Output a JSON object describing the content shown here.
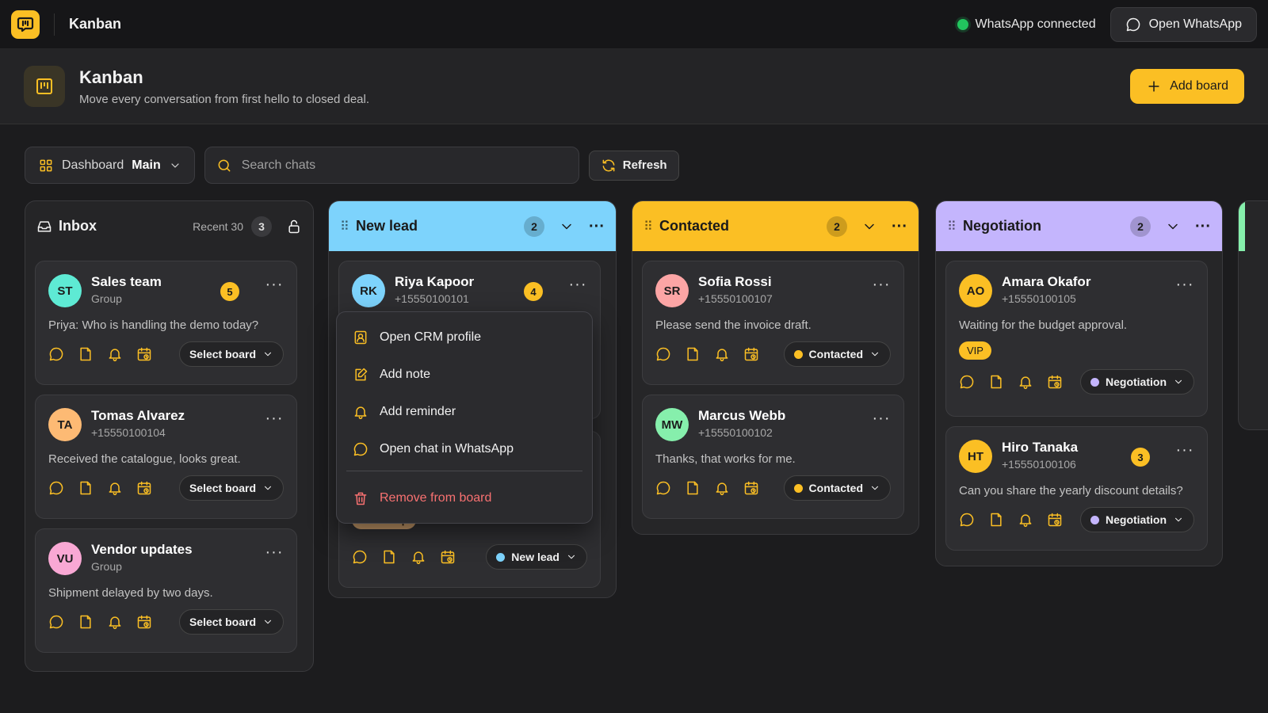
{
  "topbar": {
    "app_name": "Kanban",
    "status": "WhatsApp connected",
    "open_whatsapp": "Open WhatsApp"
  },
  "header": {
    "title": "Kanban",
    "subtitle": "Move every conversation from first hello to closed deal.",
    "add_board": "Add board"
  },
  "toolbar": {
    "dashboard_label": "Dashboard",
    "dashboard_value": "Main",
    "search_placeholder": "Search chats",
    "refresh": "Refresh"
  },
  "inbox": {
    "title": "Inbox",
    "recent_label": "Recent 30",
    "count": "3",
    "cards": [
      {
        "initials": "ST",
        "name": "Sales team",
        "sub": "Group",
        "unread": "5",
        "message": "Priya: Who is handling the demo today?",
        "board": "Select board",
        "avatar_color": "#5eead4"
      },
      {
        "initials": "TA",
        "name": "Tomas Alvarez",
        "sub": "+15550100104",
        "message": "Received the catalogue, looks great.",
        "board": "Select board",
        "avatar_color": "#fdba74"
      },
      {
        "initials": "VU",
        "name": "Vendor updates",
        "sub": "Group",
        "message": "Shipment delayed by two days.",
        "board": "Select board",
        "avatar_color": "#f9a8d4"
      }
    ]
  },
  "columns": [
    {
      "title": "New lead",
      "count": "2",
      "color": "#7dd3fc",
      "cards": [
        {
          "initials": "RK",
          "name": "Riya Kapoor",
          "sub": "+15550100101",
          "unread": "4",
          "avatar_color": "#7dd3fc"
        },
        {
          "tag": "Follow up",
          "board": "New lead",
          "status_color": "#7dd3fc"
        }
      ]
    },
    {
      "title": "Contacted",
      "count": "2",
      "color": "#fbbf24",
      "cards": [
        {
          "initials": "SR",
          "name": "Sofia Rossi",
          "sub": "+15550100107",
          "message": "Please send the invoice draft.",
          "board": "Contacted",
          "avatar_color": "#fca5a5"
        },
        {
          "initials": "MW",
          "name": "Marcus Webb",
          "sub": "+15550100102",
          "message": "Thanks, that works for me.",
          "board": "Contacted",
          "avatar_color": "#86efac"
        }
      ]
    },
    {
      "title": "Negotiation",
      "count": "2",
      "color": "#c4b5fd",
      "cards": [
        {
          "initials": "AO",
          "name": "Amara Okafor",
          "sub": "+15550100105",
          "message": "Waiting for the budget approval.",
          "tag": "VIP",
          "board": "Negotiation",
          "avatar_color": "#fbbf24"
        },
        {
          "initials": "HT",
          "name": "Hiro Tanaka",
          "sub": "+15550100106",
          "unread": "3",
          "message": "Can you share the yearly discount details?",
          "board": "Negotiation",
          "avatar_color": "#fbbf24"
        }
      ]
    }
  ],
  "menu": {
    "items": [
      "Open CRM profile",
      "Add note",
      "Add reminder",
      "Open chat in WhatsApp"
    ],
    "danger": "Remove from board"
  },
  "colors": {
    "accent": "#fbbf24",
    "connected": "#22c55e",
    "danger": "#f87171",
    "next_column": "#86efac"
  }
}
